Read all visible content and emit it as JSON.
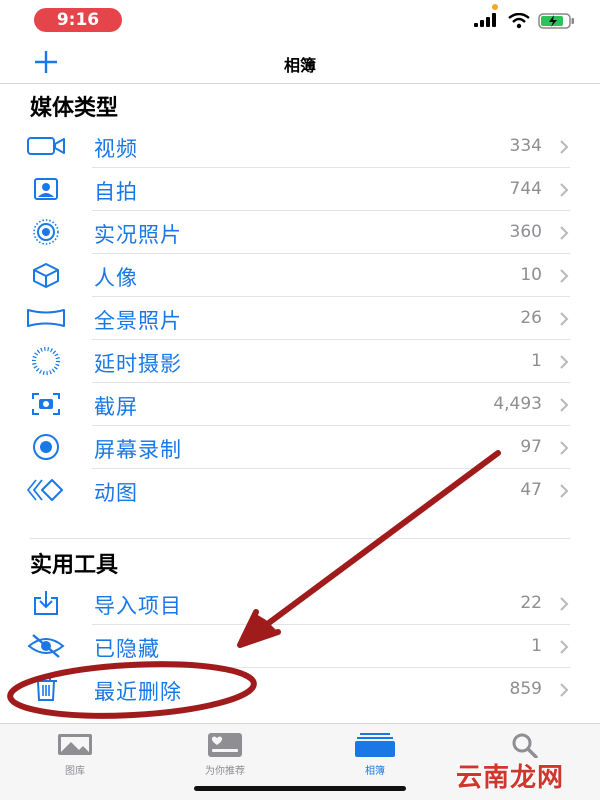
{
  "status": {
    "time": "9:16"
  },
  "nav": {
    "title": "相簿",
    "add_icon": "plus-icon"
  },
  "sections": {
    "media_types": {
      "title": "媒体类型",
      "items": [
        {
          "label": "视频",
          "count": "334",
          "icon": "video-icon"
        },
        {
          "label": "自拍",
          "count": "744",
          "icon": "selfie-icon"
        },
        {
          "label": "实况照片",
          "count": "360",
          "icon": "live-photo-icon"
        },
        {
          "label": "人像",
          "count": "10",
          "icon": "portrait-cube-icon"
        },
        {
          "label": "全景照片",
          "count": "26",
          "icon": "panorama-icon"
        },
        {
          "label": "延时摄影",
          "count": "1",
          "icon": "timelapse-icon"
        },
        {
          "label": "截屏",
          "count": "4,493",
          "icon": "screenshot-icon"
        },
        {
          "label": "屏幕录制",
          "count": "97",
          "icon": "screen-record-icon"
        },
        {
          "label": "动图",
          "count": "47",
          "icon": "animated-icon"
        }
      ]
    },
    "utilities": {
      "title": "实用工具",
      "items": [
        {
          "label": "导入项目",
          "count": "22",
          "icon": "import-icon"
        },
        {
          "label": "已隐藏",
          "count": "1",
          "icon": "hidden-eye-icon"
        },
        {
          "label": "最近删除",
          "count": "859",
          "icon": "trash-icon"
        }
      ]
    }
  },
  "tabs": [
    {
      "label": "图库",
      "icon": "photos-library-icon"
    },
    {
      "label": "为你推荐",
      "icon": "for-you-icon"
    },
    {
      "label": "相簿",
      "icon": "albums-icon",
      "active": true
    },
    {
      "label": "搜索",
      "icon": "search-icon"
    }
  ],
  "watermark": "云南龙网",
  "colors": {
    "accent": "#1a78e6",
    "annotation": "#a01c1c",
    "time_pill": "#e5454a"
  }
}
